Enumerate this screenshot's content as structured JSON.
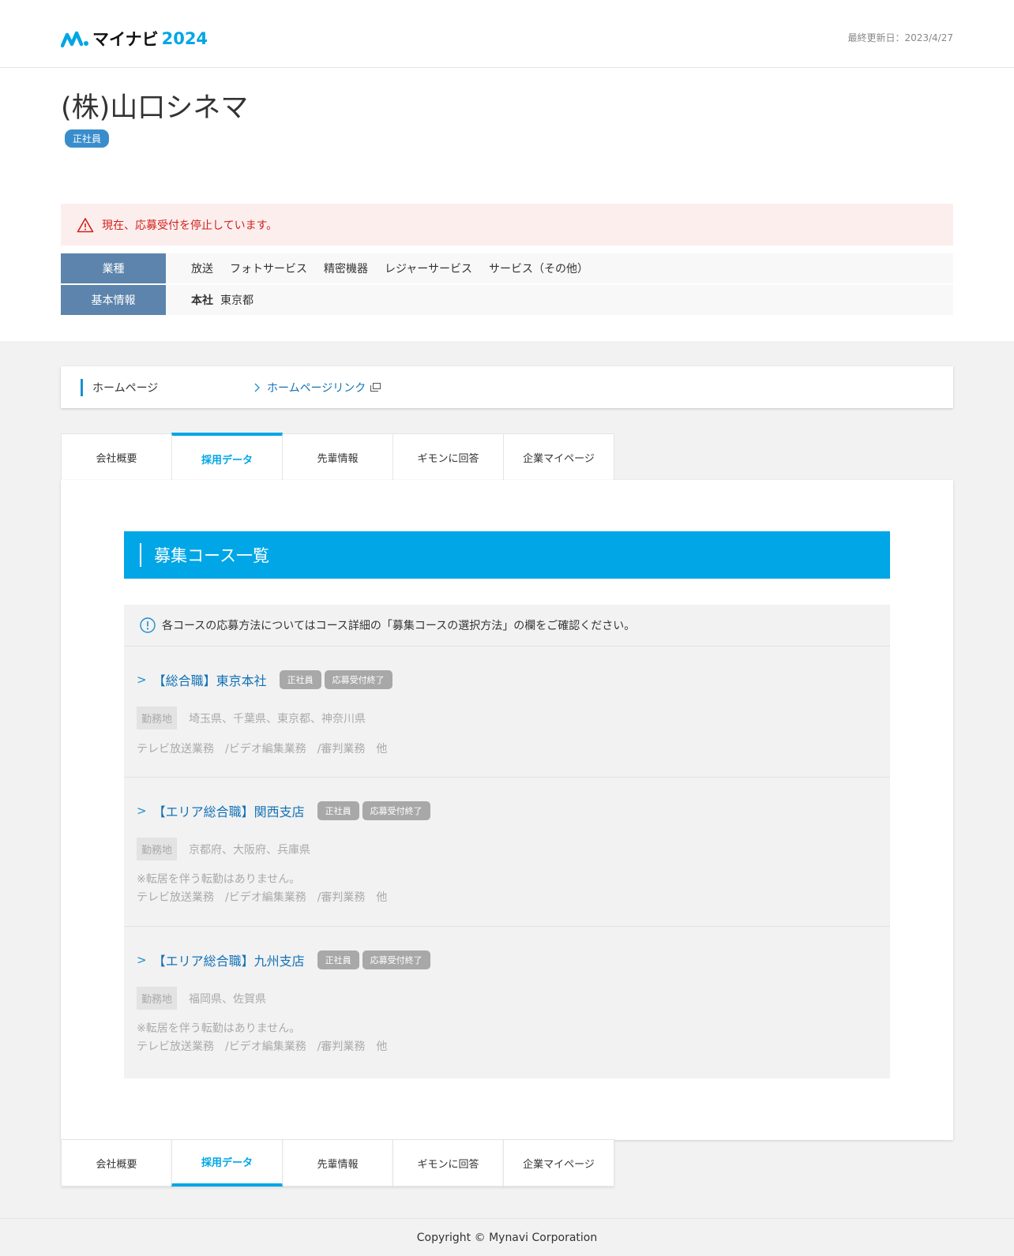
{
  "header": {
    "logo_text": "マイナビ",
    "logo_year": "2024",
    "last_updated": "最終更新日：2023/4/27"
  },
  "company": {
    "name": "(株)山口シネマ",
    "employment_badge": "正社員"
  },
  "alert": {
    "text": "現在、応募受付を停止しています。"
  },
  "info": {
    "industry_label": "業種",
    "industries": [
      "放送",
      "フォトサービス",
      "精密機器",
      "レジャーサービス",
      "サービス（その他）"
    ],
    "basic_label": "基本情報",
    "hq_label": "本社",
    "hq_value": "東京都"
  },
  "homepage": {
    "label": "ホームページ",
    "link_text": "ホームページリンク"
  },
  "tabs": [
    {
      "label": "会社概要"
    },
    {
      "label": "採用データ"
    },
    {
      "label": "先輩情報"
    },
    {
      "label": "ギモンに回答"
    },
    {
      "label": "企業マイページ"
    }
  ],
  "section": {
    "title": "募集コース一覧",
    "notice": "各コースの応募方法についてはコース詳細の「募集コースの選択方法」の欄をご確認ください。"
  },
  "courses": [
    {
      "title": "【総合職】東京本社",
      "badges": [
        "正社員",
        "応募受付終了"
      ],
      "location_label": "勤務地",
      "location": "埼玉県、千葉県、東京都、神奈川県",
      "note": "",
      "jobs": "テレビ放送業務　/ビデオ編集業務　/審判業務　他"
    },
    {
      "title": "【エリア総合職】関西支店",
      "badges": [
        "正社員",
        "応募受付終了"
      ],
      "location_label": "勤務地",
      "location": "京都府、大阪府、兵庫県",
      "note": "※転居を伴う転勤はありません。",
      "jobs": "テレビ放送業務　/ビデオ編集業務　/審判業務　他"
    },
    {
      "title": "【エリア総合職】九州支店",
      "badges": [
        "正社員",
        "応募受付終了"
      ],
      "location_label": "勤務地",
      "location": "福岡県、佐賀県",
      "note": "※転居を伴う転勤はありません。",
      "jobs": "テレビ放送業務　/ビデオ編集業務　/審判業務　他"
    }
  ],
  "footer": {
    "copyright": "Copyright © Mynavi Corporation"
  },
  "colors": {
    "accent": "#00a6e6",
    "link": "#1272b6",
    "alert_text": "#d0221b",
    "label_bg": "#5c84ac"
  }
}
